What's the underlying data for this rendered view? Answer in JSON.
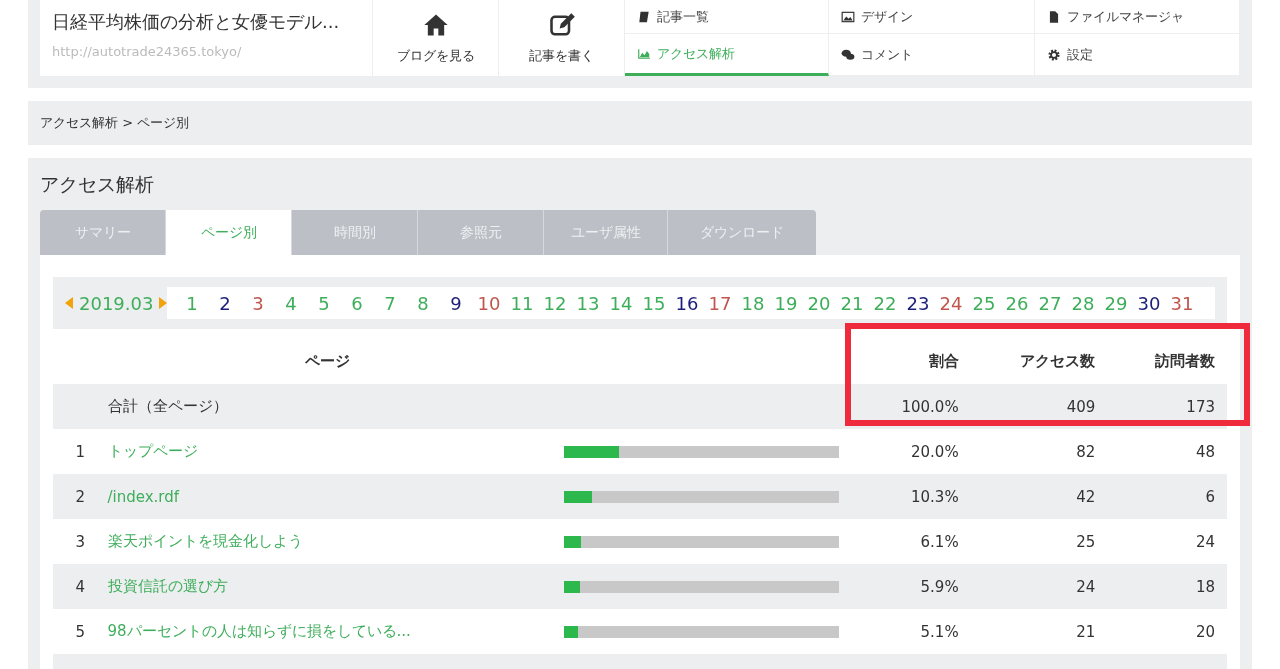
{
  "header": {
    "blog_title": "日経平均株価の分析と女優モデル...",
    "blog_url": "http://autotrade24365.tokyo/",
    "big_buttons": [
      {
        "label": "ブログを見る"
      },
      {
        "label": "記事を書く"
      }
    ],
    "menu": [
      {
        "label": "記事一覧",
        "selected": false
      },
      {
        "label": "デザイン",
        "selected": false
      },
      {
        "label": "ファイルマネージャ",
        "selected": false
      },
      {
        "label": "アクセス解析",
        "selected": true
      },
      {
        "label": "コメント",
        "selected": false
      },
      {
        "label": "設定",
        "selected": false
      }
    ]
  },
  "breadcrumb": "アクセス解析 > ページ別",
  "panel_title": "アクセス解析",
  "tabs": [
    {
      "label": "サマリー",
      "selected": false
    },
    {
      "label": "ページ別",
      "selected": true
    },
    {
      "label": "時間別",
      "selected": false
    },
    {
      "label": "参照元",
      "selected": false
    },
    {
      "label": "ユーザ属性",
      "selected": false
    },
    {
      "label": "ダウンロード",
      "selected": false
    }
  ],
  "month": "2019.03",
  "days": [
    {
      "label": "1",
      "color": "#3fae5b"
    },
    {
      "label": "2",
      "color": "#1c1f7a"
    },
    {
      "label": "3",
      "color": "#c0564e"
    },
    {
      "label": "4",
      "color": "#3fae5b"
    },
    {
      "label": "5",
      "color": "#3fae5b"
    },
    {
      "label": "6",
      "color": "#3fae5b"
    },
    {
      "label": "7",
      "color": "#3fae5b"
    },
    {
      "label": "8",
      "color": "#3fae5b"
    },
    {
      "label": "9",
      "color": "#1c1f7a"
    },
    {
      "label": "10",
      "color": "#c0564e"
    },
    {
      "label": "11",
      "color": "#3fae5b"
    },
    {
      "label": "12",
      "color": "#3fae5b"
    },
    {
      "label": "13",
      "color": "#3fae5b"
    },
    {
      "label": "14",
      "color": "#3fae5b"
    },
    {
      "label": "15",
      "color": "#3fae5b"
    },
    {
      "label": "16",
      "color": "#1c1f7a"
    },
    {
      "label": "17",
      "color": "#c0564e"
    },
    {
      "label": "18",
      "color": "#3fae5b"
    },
    {
      "label": "19",
      "color": "#3fae5b"
    },
    {
      "label": "20",
      "color": "#3fae5b"
    },
    {
      "label": "21",
      "color": "#3fae5b"
    },
    {
      "label": "22",
      "color": "#3fae5b"
    },
    {
      "label": "23",
      "color": "#1c1f7a"
    },
    {
      "label": "24",
      "color": "#c0564e"
    },
    {
      "label": "25",
      "color": "#3fae5b"
    },
    {
      "label": "26",
      "color": "#3fae5b"
    },
    {
      "label": "27",
      "color": "#3fae5b"
    },
    {
      "label": "28",
      "color": "#3fae5b"
    },
    {
      "label": "29",
      "color": "#3fae5b"
    },
    {
      "label": "30",
      "color": "#1c1f7a"
    },
    {
      "label": "31",
      "color": "#c0564e"
    }
  ],
  "table": {
    "columns": {
      "page": "ページ",
      "ratio": "割合",
      "access": "アクセス数",
      "visitors": "訪問者数"
    },
    "total": {
      "page": "合計（全ページ）",
      "ratio": "100.0%",
      "access": "409",
      "visitors": "173"
    },
    "rows": [
      {
        "rank": "1",
        "page": "トップページ",
        "level": 0.2,
        "ratio": "20.0%",
        "access": "82",
        "visitors": "48"
      },
      {
        "rank": "2",
        "page": "/index.rdf",
        "level": 0.103,
        "ratio": "10.3%",
        "access": "42",
        "visitors": "6"
      },
      {
        "rank": "3",
        "page": "楽天ポイントを現金化しよう",
        "level": 0.061,
        "ratio": "6.1%",
        "access": "25",
        "visitors": "24"
      },
      {
        "rank": "4",
        "page": "投資信託の選び方",
        "level": 0.059,
        "ratio": "5.9%",
        "access": "24",
        "visitors": "18"
      },
      {
        "rank": "5",
        "page": "98パーセントの人は知らずに損をしている...",
        "level": 0.051,
        "ratio": "5.1%",
        "access": "21",
        "visitors": "20"
      }
    ]
  }
}
